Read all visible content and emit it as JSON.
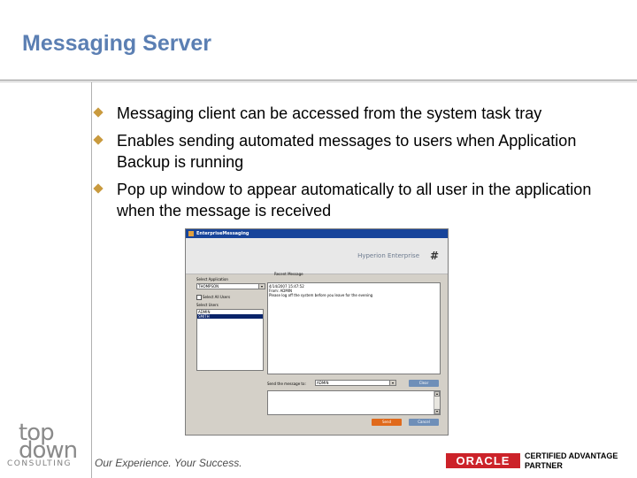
{
  "slide": {
    "title": "Messaging Server",
    "bullets": [
      "Messaging client can be accessed from the system task tray",
      "Enables sending automated messages to users when Application Backup is running",
      "Pop up window to appear automatically  to all user in the application when the message is received"
    ]
  },
  "app_window": {
    "title": "EnterpriseMessaging",
    "brand": "Hyperion Enterprise",
    "select_app_label": "Select Application",
    "app_value": "THOMPSON",
    "select_all_label": "Select All Users",
    "select_users_label": "Select Users",
    "users": [
      "ADMIN",
      "SMITH"
    ],
    "selected_user": "SMITH",
    "recent_message_label": "Recent Message",
    "recent_message_lines": [
      "4/14/2007 15:47:52",
      "From: ADMIN",
      "Please log off the system before you leave for the evening"
    ],
    "send_to_label": "Send the message to:",
    "send_to_value": "ADMIN",
    "clear_label": "Clear",
    "send_label": "Send",
    "cancel_label": "Cancel"
  },
  "footer": {
    "logo_top": "top",
    "logo_down": "down",
    "logo_consulting": "CONSULTING",
    "tagline": "Our Experience. Your Success.",
    "oracle_label": "ORACLE",
    "certified_line1": "CERTIFIED ADVANTAGE",
    "certified_line2": "PARTNER"
  },
  "colors": {
    "title": "#5b7fb3",
    "bullet": "#c99a3e",
    "oracle_red": "#cc2229"
  }
}
